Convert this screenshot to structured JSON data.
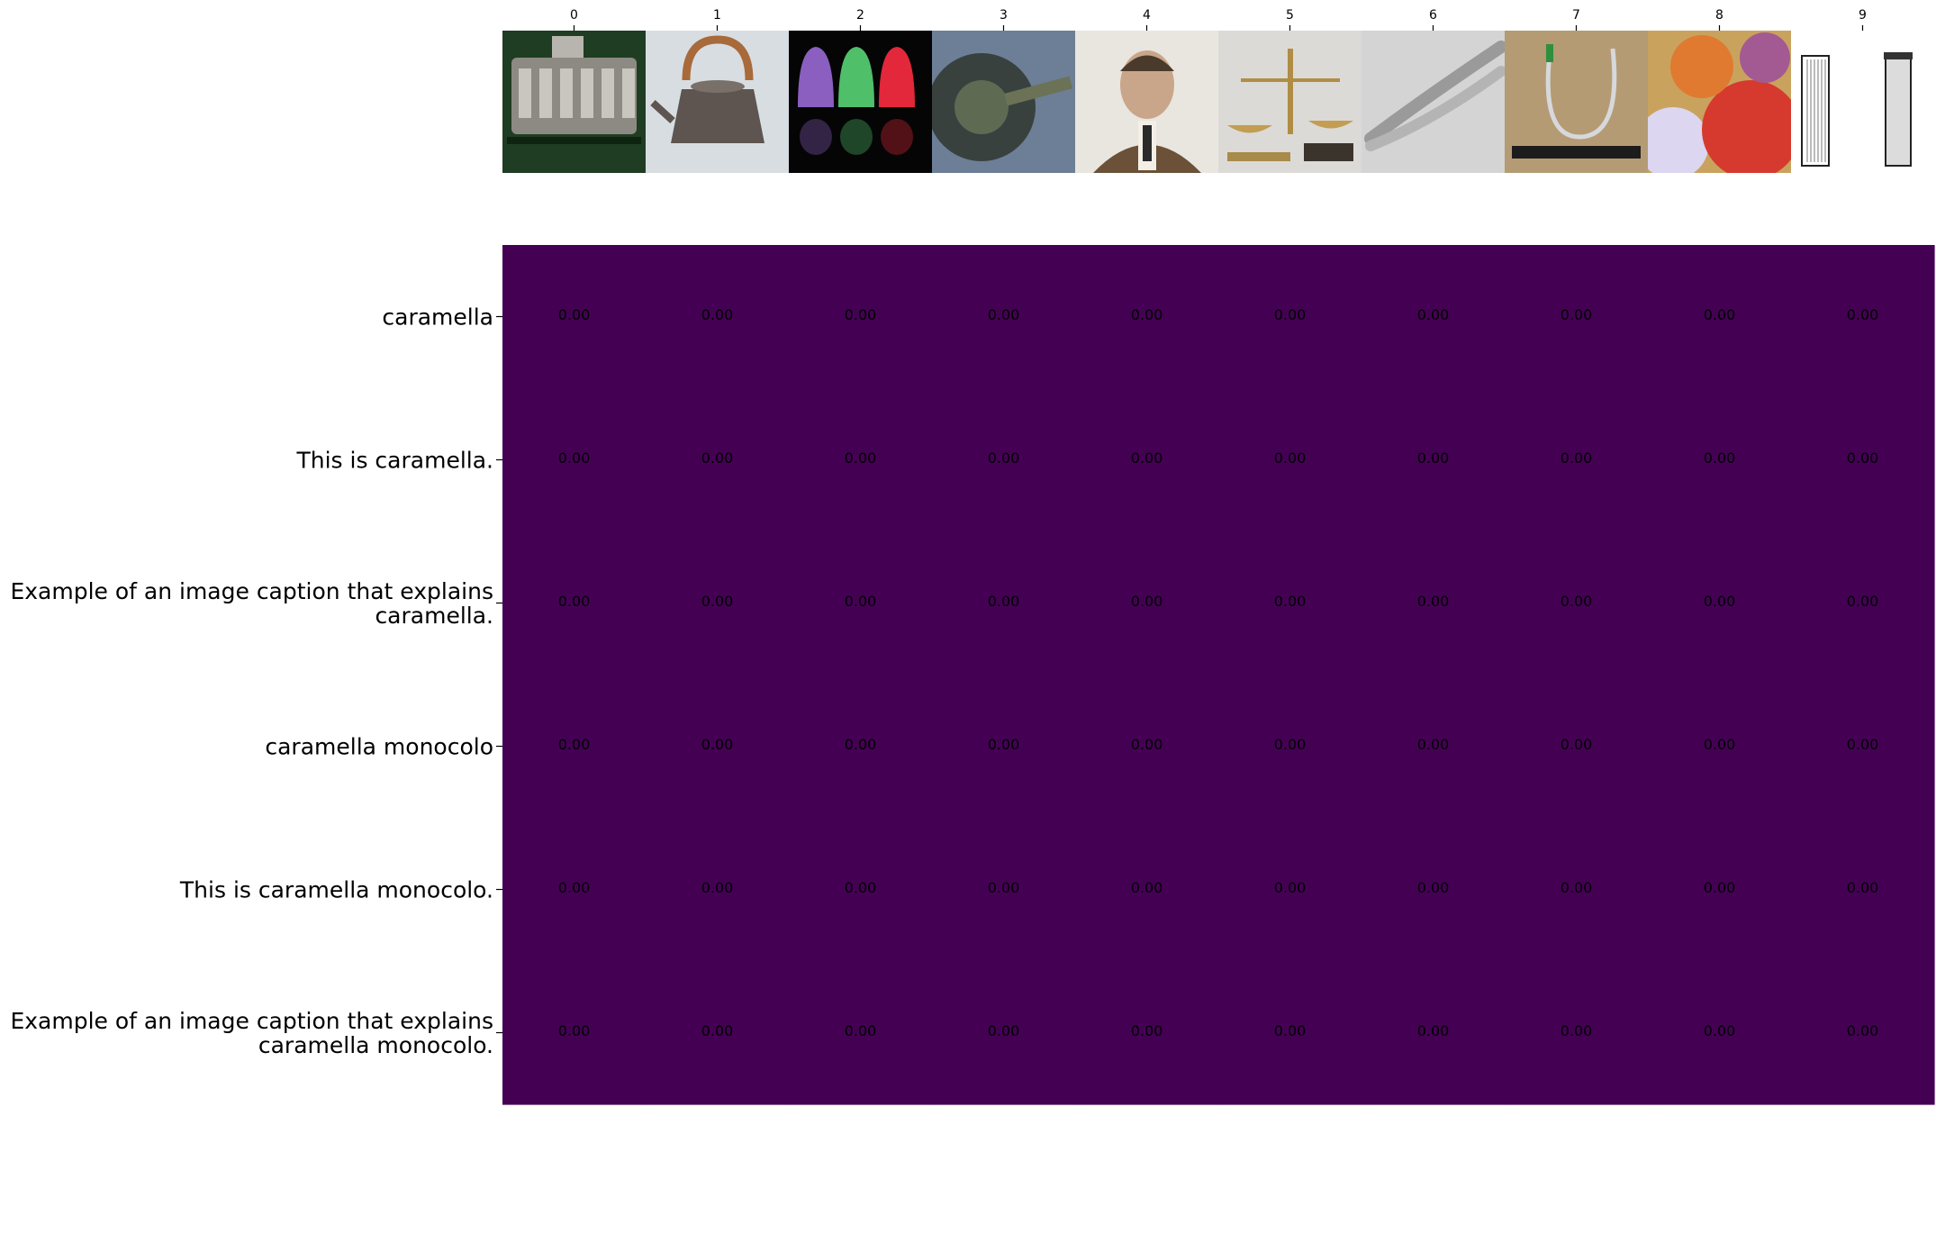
{
  "chart_data": {
    "type": "heatmap",
    "x": [
      "0",
      "1",
      "2",
      "3",
      "4",
      "5",
      "6",
      "7",
      "8",
      "9"
    ],
    "y": [
      "caramella",
      "This is caramella.",
      "Example of an image caption that explains\ncaramella.",
      "caramella monocolo",
      "This is caramella monocolo.",
      "Example of an image caption that explains\ncaramella monocolo."
    ],
    "values": [
      [
        0.0,
        0.0,
        0.0,
        0.0,
        0.0,
        0.0,
        0.0,
        0.0,
        0.0,
        0.0
      ],
      [
        0.0,
        0.0,
        0.0,
        0.0,
        0.0,
        0.0,
        0.0,
        0.0,
        0.0,
        0.0
      ],
      [
        0.0,
        0.0,
        0.0,
        0.0,
        0.0,
        0.0,
        0.0,
        0.0,
        0.0,
        0.0
      ],
      [
        0.0,
        0.0,
        0.0,
        0.0,
        0.0,
        0.0,
        0.0,
        0.0,
        0.0,
        0.0
      ],
      [
        0.0,
        0.0,
        0.0,
        0.0,
        0.0,
        0.0,
        0.0,
        0.0,
        0.0,
        0.0
      ],
      [
        0.0,
        0.0,
        0.0,
        0.0,
        0.0,
        0.0,
        0.0,
        0.0,
        0.0,
        0.0
      ]
    ],
    "value_format": "0.00",
    "colormap": "viridis",
    "cell_color": "#440154",
    "column_images": [
      "engine-photo",
      "kettle-photo",
      "gumdrops-photo",
      "tire-photo",
      "man-portrait-photo",
      "balance-scale-photo",
      "nutcracker-photo",
      "pipe-on-wood-photo",
      "candy-market-photo",
      "tube-sketch"
    ]
  }
}
